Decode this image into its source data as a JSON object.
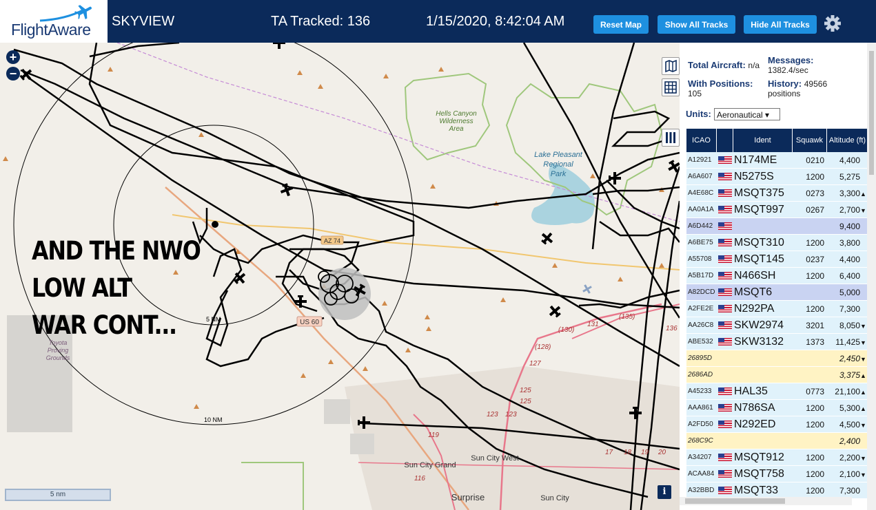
{
  "header": {
    "logo_text": "FlightAware",
    "app_title": "SKYVIEW",
    "tracked": "TA Tracked: 136",
    "datetime": "1/15/2020, 8:42:04 AM",
    "buttons": {
      "reset": "Reset Map",
      "show_all": "Show All Tracks",
      "hide_all": "Hide All Tracks"
    },
    "settings_icon": "gear-icon"
  },
  "map": {
    "zoom_in": "+",
    "zoom_out": "−",
    "overlay_lines": [
      "AND THE NWO",
      "LOW ALT",
      "WAR CONT..."
    ],
    "places": {
      "hells_canyon": [
        "Hells Canyon",
        "Wilderness",
        "Area"
      ],
      "lake_pleasant": [
        "Lake Pleasant",
        "Regional",
        "Park"
      ],
      "toyota": [
        "Toyota",
        "Proving",
        "Grounds"
      ],
      "sun_city_grand": "Sun City Grand",
      "sun_city_west": "Sun City West",
      "surprise": "Surprise",
      "sun_city": "Sun City"
    },
    "road_labels": {
      "az74": "AZ 74",
      "us60": "US 60"
    },
    "ring_labels": {
      "r5": "5 NM",
      "r10": "10 NM"
    },
    "route_numbers": [
      "131",
      "(135)",
      "(130)",
      "(128)",
      "127",
      "125",
      "125",
      "123",
      "123",
      "119",
      "116",
      "17",
      "18",
      "19",
      "20",
      "136"
    ],
    "scale": "5 nm",
    "info": "i",
    "tool_icons": [
      "map-layers-icon",
      "grid-icon",
      "columns-icon"
    ]
  },
  "sidebar": {
    "total_aircraft_label": "Total Aircraft:",
    "total_aircraft_value": "n/a",
    "with_positions_label": "With Positions:",
    "with_positions_value": "105",
    "messages_label": "Messages:",
    "messages_value": "1382.4/sec",
    "history_label": "History:",
    "history_value": "49566",
    "history_unit": "positions",
    "units_label": "Units:",
    "units_value": "Aeronautical ▾",
    "columns": [
      "ICAO",
      "",
      "Ident",
      "Squawk",
      "Altitude (ft)"
    ],
    "rows": [
      {
        "icao": "A12921",
        "flag": true,
        "ident": "N174ME",
        "squawk": "0210",
        "alt": "4,400",
        "trend": "",
        "style": ""
      },
      {
        "icao": "A6A607",
        "flag": true,
        "ident": "N5275S",
        "squawk": "1200",
        "alt": "5,275",
        "trend": "",
        "style": ""
      },
      {
        "icao": "A4E68C",
        "flag": true,
        "ident": "MSQT375",
        "squawk": "0273",
        "alt": "3,300",
        "trend": "▲",
        "style": ""
      },
      {
        "icao": "AA0A1A",
        "flag": true,
        "ident": "MSQT997",
        "squawk": "0267",
        "alt": "2,700",
        "trend": "▼",
        "style": ""
      },
      {
        "icao": "A6D442",
        "flag": true,
        "ident": "",
        "squawk": "",
        "alt": "9,400",
        "trend": "",
        "style": "sel"
      },
      {
        "icao": "A6BE75",
        "flag": true,
        "ident": "MSQT310",
        "squawk": "1200",
        "alt": "3,800",
        "trend": "",
        "style": ""
      },
      {
        "icao": "A55708",
        "flag": true,
        "ident": "MSQT145",
        "squawk": "0237",
        "alt": "4,400",
        "trend": "",
        "style": ""
      },
      {
        "icao": "A5B17D",
        "flag": true,
        "ident": "N466SH",
        "squawk": "1200",
        "alt": "6,400",
        "trend": "",
        "style": ""
      },
      {
        "icao": "A82DCD",
        "flag": true,
        "ident": "MSQT6",
        "squawk": "",
        "alt": "5,000",
        "trend": "",
        "style": "sel"
      },
      {
        "icao": "A2FE2E",
        "flag": true,
        "ident": "N292PA",
        "squawk": "1200",
        "alt": "7,300",
        "trend": "",
        "style": ""
      },
      {
        "icao": "AA26C8",
        "flag": true,
        "ident": "SKW2974",
        "squawk": "3201",
        "alt": "8,050",
        "trend": "▼",
        "style": ""
      },
      {
        "icao": "ABE532",
        "flag": true,
        "ident": "SKW3132",
        "squawk": "1373",
        "alt": "11,425",
        "trend": "▼",
        "style": ""
      },
      {
        "icao": "26895D",
        "flag": false,
        "ident": "",
        "squawk": "",
        "alt": "2,450",
        "trend": "▼",
        "style": "nopos"
      },
      {
        "icao": "2686AD",
        "flag": false,
        "ident": "",
        "squawk": "",
        "alt": "3,375",
        "trend": "▲",
        "style": "nopos"
      },
      {
        "icao": "A45233",
        "flag": true,
        "ident": "HAL35",
        "squawk": "0773",
        "alt": "21,100",
        "trend": "▲",
        "style": ""
      },
      {
        "icao": "AAA861",
        "flag": true,
        "ident": "N786SA",
        "squawk": "1200",
        "alt": "5,300",
        "trend": "▲",
        "style": ""
      },
      {
        "icao": "A2FD50",
        "flag": true,
        "ident": "N292ED",
        "squawk": "1200",
        "alt": "4,500",
        "trend": "▼",
        "style": ""
      },
      {
        "icao": "268C9C",
        "flag": false,
        "ident": "",
        "squawk": "",
        "alt": "2,400",
        "trend": "",
        "style": "nopos"
      },
      {
        "icao": "A34207",
        "flag": true,
        "ident": "MSQT912",
        "squawk": "1200",
        "alt": "2,200",
        "trend": "▼",
        "style": ""
      },
      {
        "icao": "ACAA84",
        "flag": true,
        "ident": "MSQT758",
        "squawk": "1200",
        "alt": "2,100",
        "trend": "▼",
        "style": ""
      },
      {
        "icao": "A32BBD",
        "flag": true,
        "ident": "MSQT33",
        "squawk": "1200",
        "alt": "7,300",
        "trend": "",
        "style": ""
      }
    ]
  },
  "colors": {
    "header_bg": "#0b2a5a",
    "button_bg": "#1e90e0",
    "row_default": "#e0f2fb",
    "row_selected": "#c9d3f2",
    "row_no_position": "#fff3c4",
    "track": "#000000",
    "lake": "#aad3df",
    "wilderness_border": "#9fc77c"
  }
}
